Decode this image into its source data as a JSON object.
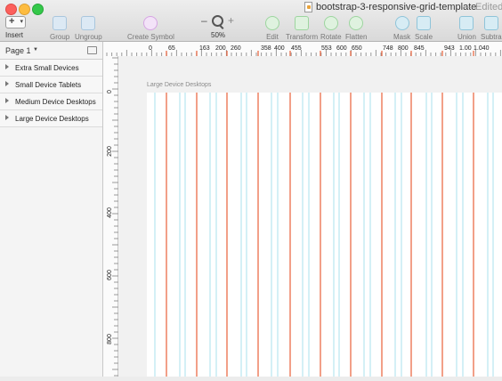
{
  "window": {
    "title": "bootstrap-3-responsive-grid-template",
    "status": "— Edited"
  },
  "toolbar": {
    "insert": "Insert",
    "group": "Group",
    "ungroup": "Ungroup",
    "create_symbol": "Create Symbol",
    "zoom_minus": "–",
    "zoom_plus": "+",
    "zoom_level": "50%",
    "edit": "Edit",
    "transform": "Transform",
    "rotate": "Rotate",
    "flatten": "Flatten",
    "mask": "Mask",
    "scale": "Scale",
    "union": "Union",
    "subtract": "Subtra"
  },
  "sidebar": {
    "page_label": "Page 1",
    "layers": [
      {
        "label": "Extra Small Devices"
      },
      {
        "label": "Small Device Tablets"
      },
      {
        "label": "Medium Device Desktops"
      },
      {
        "label": "Large Device Desktops"
      }
    ]
  },
  "ruler": {
    "horizontal_labels": [
      "0",
      "65",
      "163",
      "200",
      "260",
      "358",
      "400",
      "455",
      "553",
      "600",
      "650",
      "748",
      "800",
      "845",
      "943",
      "1.00",
      "1.040"
    ],
    "vertical_labels": [
      "0",
      "200",
      "400",
      "600",
      "800"
    ]
  },
  "canvas": {
    "artboard_label": "Large Device Desktops"
  },
  "colors": {
    "guide_orange": "#e8603a",
    "guide_cyan": "#a8e1ee",
    "artboard": "#ffffff"
  }
}
